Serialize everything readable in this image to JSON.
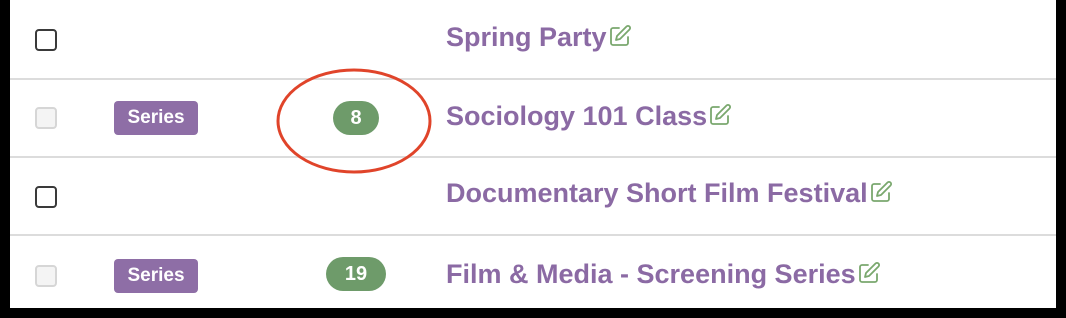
{
  "colors": {
    "link_purple": "#8b6aa4",
    "series_badge_bg": "#8e6ea6",
    "count_pill_bg": "#6e9b6a",
    "edit_icon_green": "#7aa86e",
    "annotation_red": "#e0442a",
    "row_divider": "#dcdcdc"
  },
  "rows": [
    {
      "checkbox_enabled": true,
      "series_label": "",
      "count": "",
      "title": "Spring Party",
      "edit_icon": "edit-icon"
    },
    {
      "checkbox_enabled": false,
      "series_label": "Series",
      "count": "8",
      "title": "Sociology 101 Class",
      "edit_icon": "edit-icon"
    },
    {
      "checkbox_enabled": true,
      "series_label": "",
      "count": "",
      "title": "Documentary Short Film Festival",
      "edit_icon": "edit-icon"
    },
    {
      "checkbox_enabled": false,
      "series_label": "Series",
      "count": "19",
      "title": "Film & Media - Screening Series",
      "edit_icon": "edit-icon"
    }
  ]
}
